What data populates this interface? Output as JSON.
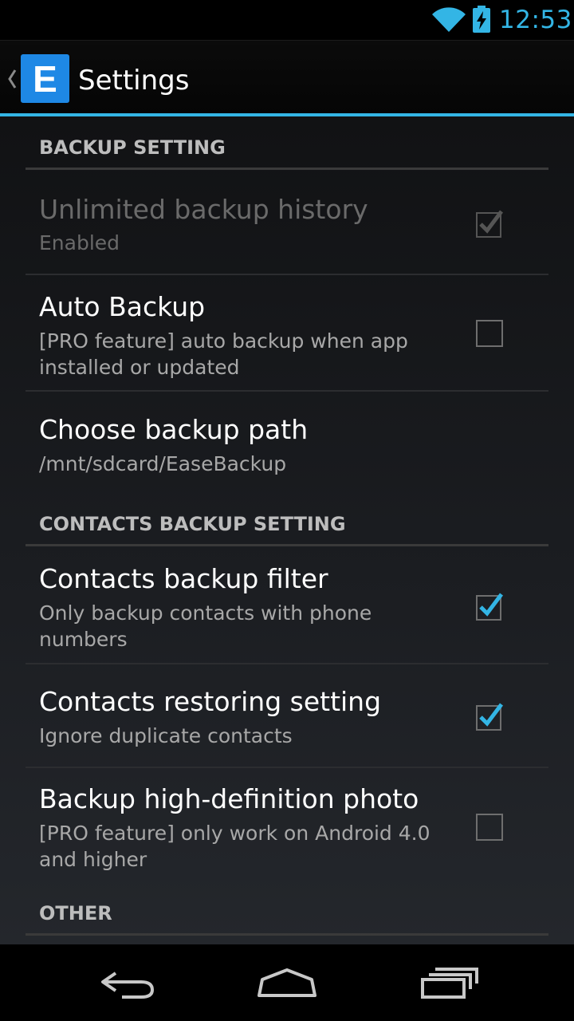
{
  "status_bar": {
    "time": "12:53",
    "icons": [
      "wifi-icon",
      "battery-charging-icon"
    ],
    "accent_color": "#33b5e5"
  },
  "action_bar": {
    "app_icon_letter": "E",
    "title": "Settings",
    "app_icon_color": "#1e88e5"
  },
  "sections": {
    "backup": {
      "header": "BACKUP SETTING",
      "unlimited_history": {
        "title": "Unlimited backup history",
        "summary": "Enabled",
        "checked": true,
        "enabled": false
      },
      "auto_backup": {
        "title": "Auto Backup",
        "summary": "[PRO feature] auto backup when app installed or updated",
        "checked": false
      },
      "backup_path": {
        "title": "Choose backup path",
        "summary": "/mnt/sdcard/EaseBackup"
      }
    },
    "contacts": {
      "header": "CONTACTS BACKUP SETTING",
      "filter": {
        "title": "Contacts backup filter",
        "summary": "Only backup contacts with phone numbers",
        "checked": true
      },
      "restoring": {
        "title": "Contacts restoring setting",
        "summary": "Ignore duplicate contacts",
        "checked": true
      },
      "hd_photo": {
        "title": "Backup high-definition photo",
        "summary": "[PRO feature] only work on Android 4.0 and higher",
        "checked": false
      }
    },
    "other": {
      "header": "OTHER"
    }
  },
  "nav_bar": {
    "buttons": [
      "back-icon",
      "home-icon",
      "recent-apps-icon"
    ]
  }
}
